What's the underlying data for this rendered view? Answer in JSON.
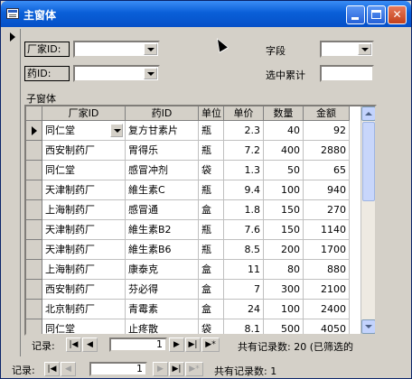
{
  "window": {
    "title": "主窗体"
  },
  "form": {
    "manufacturer_label": "厂家ID:",
    "drug_label": "药ID:",
    "field_label": "字段",
    "selected_total_label": "选中累计",
    "subform_label": "子窗体"
  },
  "grid": {
    "columns": [
      "厂家ID",
      "药ID",
      "单位",
      "单价",
      "数量",
      "金额"
    ],
    "rows": [
      {
        "manufacturer": "同仁堂",
        "drug": "复方甘素片",
        "unit": "瓶",
        "price": "2.3",
        "qty": "40",
        "amount": "92"
      },
      {
        "manufacturer": "西安制药厂",
        "drug": "胃得乐",
        "unit": "瓶",
        "price": "7.2",
        "qty": "400",
        "amount": "2880"
      },
      {
        "manufacturer": "同仁堂",
        "drug": "感冒冲剂",
        "unit": "袋",
        "price": "1.3",
        "qty": "50",
        "amount": "65"
      },
      {
        "manufacturer": "天津制药厂",
        "drug": "維生素C",
        "unit": "瓶",
        "price": "9.4",
        "qty": "100",
        "amount": "940"
      },
      {
        "manufacturer": "上海制药厂",
        "drug": "感冒通",
        "unit": "盒",
        "price": "1.8",
        "qty": "150",
        "amount": "270"
      },
      {
        "manufacturer": "天津制药厂",
        "drug": "維生素B2",
        "unit": "瓶",
        "price": "7.6",
        "qty": "150",
        "amount": "1140"
      },
      {
        "manufacturer": "天津制药厂",
        "drug": "維生素B6",
        "unit": "瓶",
        "price": "8.5",
        "qty": "200",
        "amount": "1700"
      },
      {
        "manufacturer": "上海制药厂",
        "drug": "康泰克",
        "unit": "盒",
        "price": "11",
        "qty": "80",
        "amount": "880"
      },
      {
        "manufacturer": "西安制药厂",
        "drug": "芬必得",
        "unit": "盒",
        "price": "7",
        "qty": "300",
        "amount": "2100"
      },
      {
        "manufacturer": "北京制药厂",
        "drug": "青霉素",
        "unit": "盒",
        "price": "24",
        "qty": "100",
        "amount": "2400"
      },
      {
        "manufacturer": "同仁堂",
        "drug": "止疼散",
        "unit": "袋",
        "price": "8.1",
        "qty": "500",
        "amount": "4050"
      }
    ]
  },
  "subform_nav": {
    "label": "记录:",
    "current": "1",
    "status": "共有记录数: 20 (已筛选的"
  },
  "main_nav": {
    "label": "记录:",
    "current": "1",
    "status": "共有记录数: 1"
  },
  "colors": {
    "titlebar": "#0a5fd8",
    "window_bg": "#d4d0c8"
  }
}
